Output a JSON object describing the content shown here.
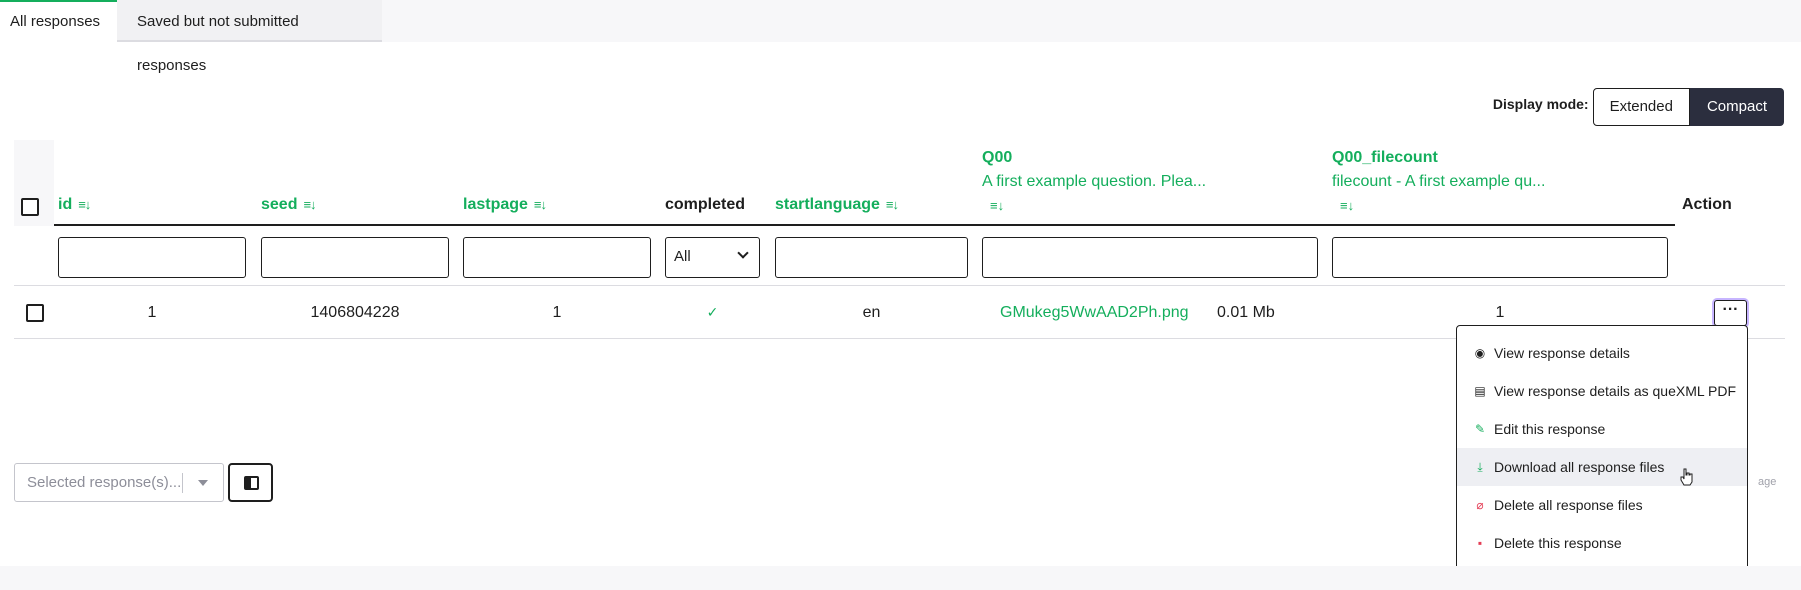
{
  "tabs": [
    {
      "label": "All responses",
      "active": true
    },
    {
      "label": "Saved but not submitted responses",
      "active": false
    }
  ],
  "display_mode": {
    "label": "Display mode:",
    "options": [
      "Extended",
      "Compact"
    ],
    "selected": "Compact"
  },
  "table": {
    "columns": {
      "id": "id",
      "seed": "seed",
      "lastpage": "lastpage",
      "completed": "completed",
      "startlanguage": "startlanguage",
      "q00_code": "Q00",
      "q00_text": "A first example question. Plea...",
      "q00fc_code": "Q00_filecount",
      "q00fc_text": "filecount - A first example qu...",
      "action": "Action"
    },
    "sort_icon": "≡↓",
    "completed_filter": "All",
    "rows": [
      {
        "id": "1",
        "seed": "1406804228",
        "lastpage": "1",
        "completed_icon": "✓",
        "startlanguage": "en",
        "file_name": "GMukeg5WwAAD2Ph.png",
        "file_size": "0.01 Mb",
        "filecount": "1",
        "action_label": "···"
      }
    ]
  },
  "action_menu": {
    "items": [
      {
        "label": "View response details",
        "icon": "eye-icon",
        "glyph": "◉"
      },
      {
        "label": "View response details as queXML PDF",
        "icon": "document-icon",
        "glyph": "▤"
      },
      {
        "label": "Edit this response",
        "icon": "pencil-icon",
        "glyph": "✎"
      },
      {
        "label": "Download all response files",
        "icon": "download-icon",
        "glyph": "⤓"
      },
      {
        "label": "Delete all response files",
        "icon": "paperclip-icon",
        "glyph": "⌀"
      },
      {
        "label": "Delete this response",
        "icon": "trash-icon",
        "glyph": "▪"
      }
    ],
    "hovered_index": 3
  },
  "bulk_action": {
    "placeholder": "Selected response(s)..."
  },
  "page_hint": "age",
  "colors": {
    "accent": "#14ae5c",
    "danger": "#e43d55",
    "dark": "#2b2e3e"
  }
}
